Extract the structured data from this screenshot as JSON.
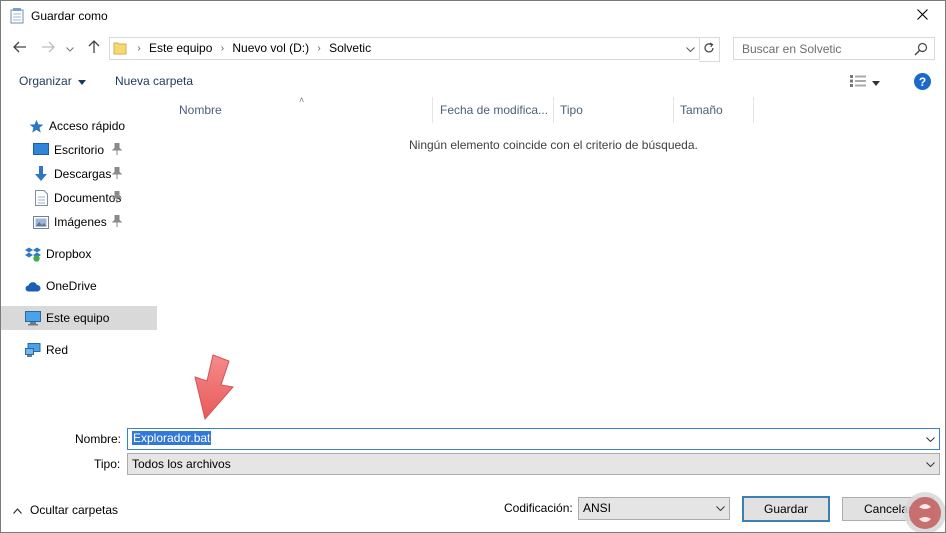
{
  "window": {
    "title": "Guardar como"
  },
  "address_bar": {
    "breadcrumbs": [
      "Este equipo",
      "Nuevo vol (D:)",
      "Solvetic"
    ]
  },
  "search": {
    "placeholder": "Buscar en Solvetic"
  },
  "toolbar": {
    "organize_label": "Organizar",
    "new_folder_label": "Nueva carpeta",
    "help_label": "?"
  },
  "nav_pane": {
    "quick_access": "Acceso rápido",
    "items": [
      {
        "label": "Escritorio",
        "icon": "desktop-icon",
        "pinned": true
      },
      {
        "label": "Descargas",
        "icon": "download-icon",
        "pinned": true
      },
      {
        "label": "Documentos",
        "icon": "document-icon",
        "pinned": true
      },
      {
        "label": "Imágenes",
        "icon": "image-icon",
        "pinned": true
      }
    ],
    "dropbox": "Dropbox",
    "onedrive": "OneDrive",
    "this_pc": "Este equipo",
    "network": "Red"
  },
  "file_list": {
    "columns": [
      "Nombre",
      "Fecha de modifica...",
      "Tipo",
      "Tamaño"
    ],
    "empty_message": "Ningún elemento coincide con el criterio de búsqueda."
  },
  "form": {
    "filename_label": "Nombre:",
    "filename_value": "Explorador.bat",
    "type_label": "Tipo:",
    "type_value": "Todos los archivos",
    "encoding_label": "Codificación:",
    "encoding_value": "ANSI"
  },
  "footer": {
    "hide_folders_label": "Ocultar carpetas",
    "save_label": "Guardar",
    "cancel_label": "Cancelar"
  },
  "colors": {
    "accent": "#1b6ac9",
    "selection": "#3378d6",
    "annotation_arrow": "#f26b6b"
  }
}
